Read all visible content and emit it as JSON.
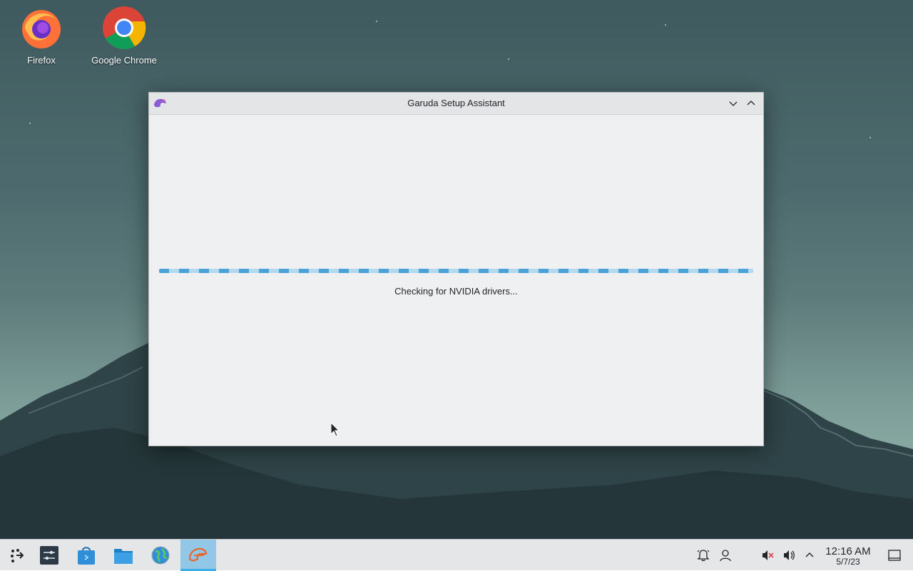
{
  "desktop": {
    "icons": [
      {
        "label": "Firefox",
        "icon": "firefox-icon"
      },
      {
        "label": "Google Chrome",
        "icon": "chrome-icon"
      }
    ]
  },
  "window": {
    "title": "Garuda Setup Assistant",
    "status": "Checking for NVIDIA drivers...",
    "progress": "indeterminate",
    "accent": "#4aa3d8"
  },
  "taskbar": {
    "launcher_icon": "application-launcher-icon",
    "items": [
      {
        "name": "settings-icon"
      },
      {
        "name": "software-store-icon"
      },
      {
        "name": "file-manager-icon"
      },
      {
        "name": "web-browser-icon"
      },
      {
        "name": "garuda-setup-assistant-icon",
        "active": true
      }
    ],
    "tray": [
      "notifications-icon",
      "user-icon",
      "audio-muted-icon",
      "volume-icon",
      "expand-tray-icon"
    ],
    "clock": {
      "time": "12:16 AM",
      "date": "5/7/23"
    },
    "show_desktop_icon": "show-desktop-icon"
  }
}
